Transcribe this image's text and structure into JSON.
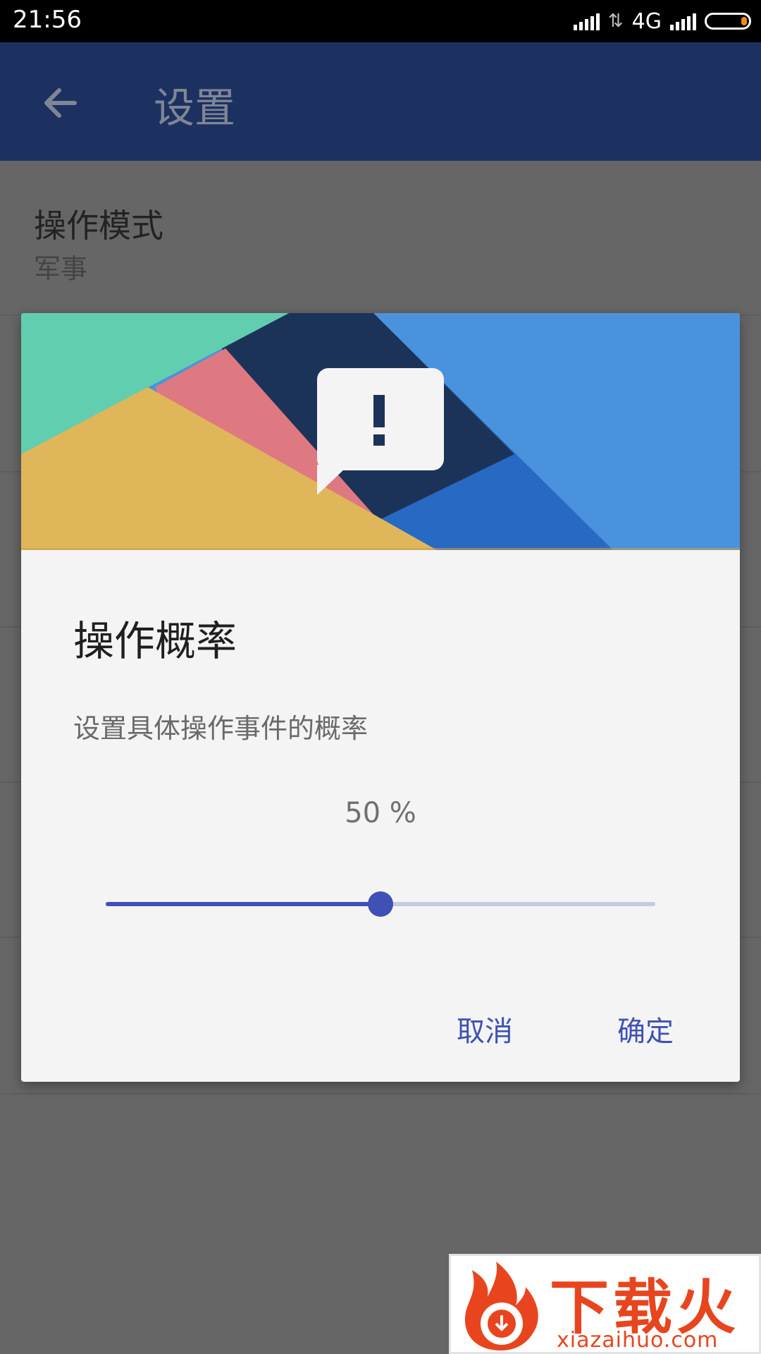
{
  "status_bar": {
    "time": "21:56",
    "network": "4G"
  },
  "app_bar": {
    "back_icon": "arrow-left-icon",
    "title": "设置"
  },
  "settings": {
    "items": [
      {
        "label": "操作模式",
        "value": "军事"
      }
    ]
  },
  "dialog": {
    "header_icon": "alert-speech-bubble-icon",
    "title": "操作概率",
    "message": "设置具体操作事件的概率",
    "value_text": "50 %",
    "slider_value": 0.5,
    "cancel_label": "取消",
    "confirm_label": "确定",
    "accent_color": "#3f51b5"
  },
  "watermark": {
    "brand": "下载火",
    "url": "xiazaihuo.com"
  }
}
